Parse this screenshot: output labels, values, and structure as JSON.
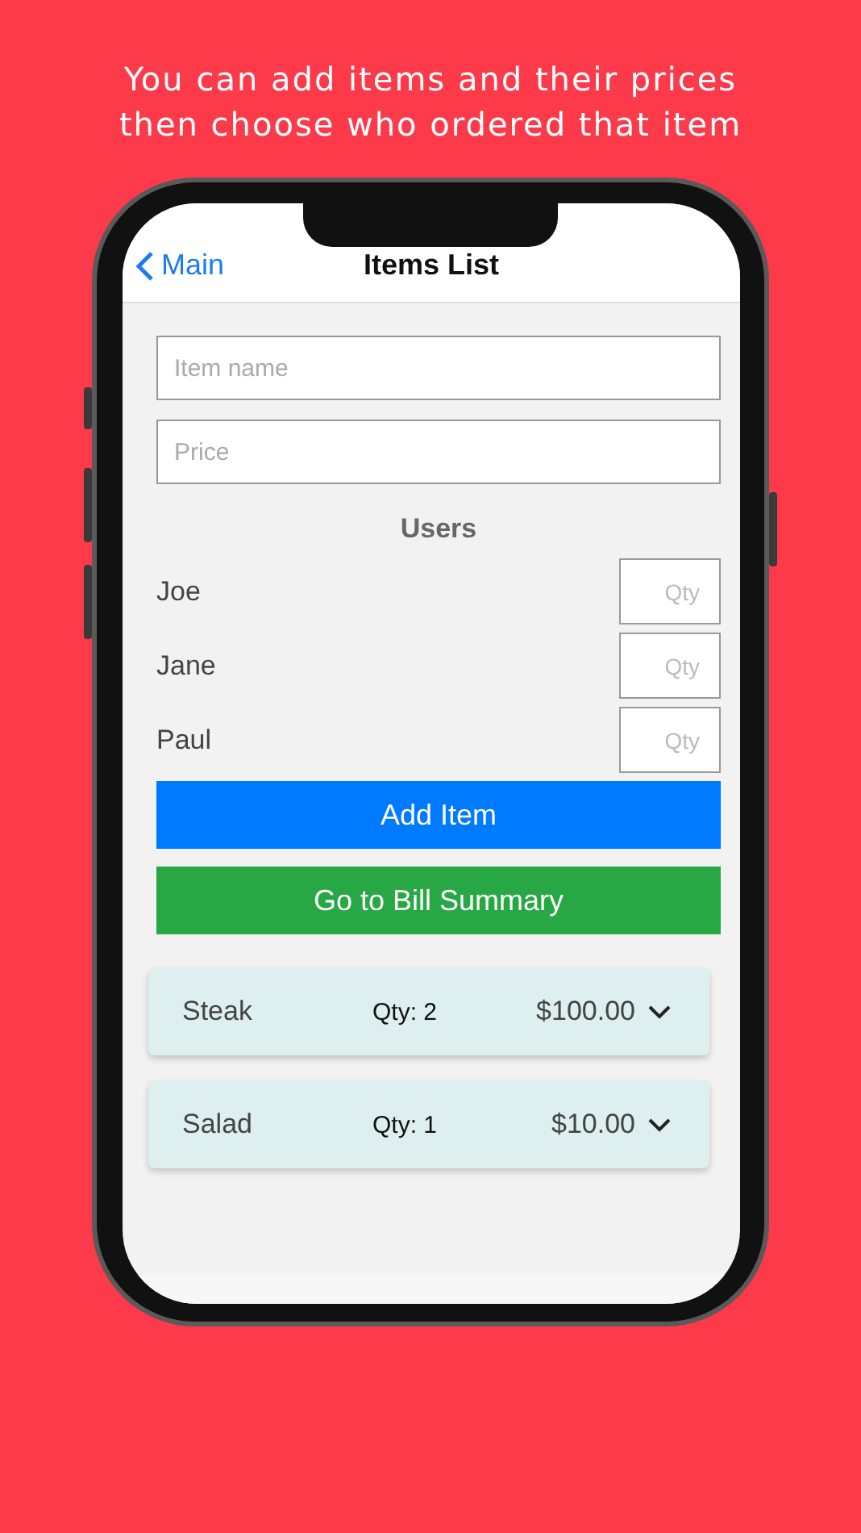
{
  "caption_lines": [
    "You can add items and their prices",
    "then choose who ordered that item"
  ],
  "nav": {
    "back_label": "Main",
    "title": "Items List"
  },
  "form": {
    "item_name": {
      "placeholder": "Item name"
    },
    "price": {
      "placeholder": "Price"
    }
  },
  "users_heading": "Users",
  "users": [
    {
      "name": "Joe",
      "qty_placeholder": "Qty"
    },
    {
      "name": "Jane",
      "qty_placeholder": "Qty"
    },
    {
      "name": "Paul",
      "qty_placeholder": "Qty"
    }
  ],
  "buttons": [
    {
      "label": "Add Item",
      "kind": "primary"
    },
    {
      "label": "Go to Bill Summary",
      "kind": "success"
    }
  ],
  "items": [
    {
      "name": "Steak",
      "qty": "Qty: 2",
      "price": "$100.00",
      "expanded": false
    },
    {
      "name": "Salad",
      "qty": "Qty: 1",
      "price": "$10.00",
      "expanded": false
    }
  ]
}
